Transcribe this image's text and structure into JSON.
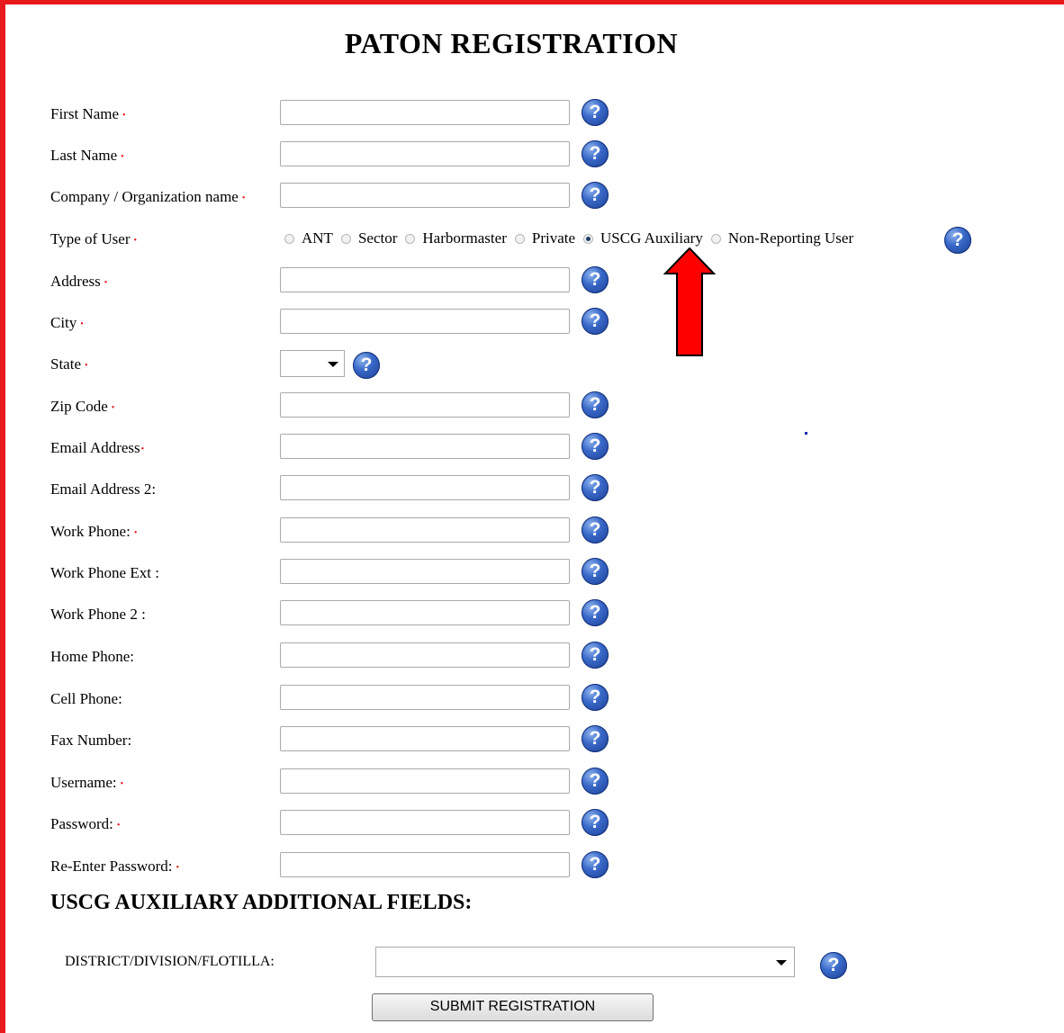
{
  "page": {
    "title": "PATON REGISTRATION"
  },
  "form": {
    "required_marker": "•",
    "help_glyph": "?",
    "fields": [
      {
        "label": "First Name",
        "required": true,
        "value": ""
      },
      {
        "label": "Last Name",
        "required": true,
        "value": ""
      },
      {
        "label": "Company / Organization name",
        "required": true,
        "value": ""
      },
      {
        "label": "Type of User",
        "required": true
      },
      {
        "label": "Address",
        "required": true,
        "value": ""
      },
      {
        "label": "City",
        "required": true,
        "value": ""
      },
      {
        "label": "State",
        "required": true,
        "value": ""
      },
      {
        "label": "Zip Code",
        "required": true,
        "value": ""
      },
      {
        "label": "Email Address",
        "required": true,
        "value": ""
      },
      {
        "label": "Email Address 2:",
        "required": false,
        "value": ""
      },
      {
        "label": "Work Phone:",
        "required": true,
        "value": ""
      },
      {
        "label": "Work Phone Ext :",
        "required": false,
        "value": ""
      },
      {
        "label": "Work Phone 2 :",
        "required": false,
        "value": ""
      },
      {
        "label": "Home Phone:",
        "required": false,
        "value": ""
      },
      {
        "label": "Cell Phone:",
        "required": false,
        "value": ""
      },
      {
        "label": "Fax Number:",
        "required": false,
        "value": ""
      },
      {
        "label": "Username:",
        "required": true,
        "value": ""
      },
      {
        "label": "Password:",
        "required": true,
        "value": ""
      },
      {
        "label": "Re-Enter Password:",
        "required": true,
        "value": ""
      }
    ],
    "user_types": [
      {
        "label": "ANT",
        "checked": false
      },
      {
        "label": "Sector",
        "checked": false
      },
      {
        "label": "Harbormaster",
        "checked": false
      },
      {
        "label": "Private",
        "checked": false
      },
      {
        "label": "USCG Auxiliary",
        "checked": true
      },
      {
        "label": "Non-Reporting User",
        "checked": false
      }
    ]
  },
  "auxiliary_section": {
    "title": "USCG AUXILIARY ADDITIONAL FIELDS:",
    "district_label": "DISTRICT/DIVISION/FLOTILLA:",
    "district_value": ""
  },
  "submit_label": "SUBMIT REGISTRATION",
  "colors": {
    "frame": "#e8191d",
    "required": "#e8191d",
    "help_icon": "#2a55b8",
    "arrow": "#ff0000"
  }
}
